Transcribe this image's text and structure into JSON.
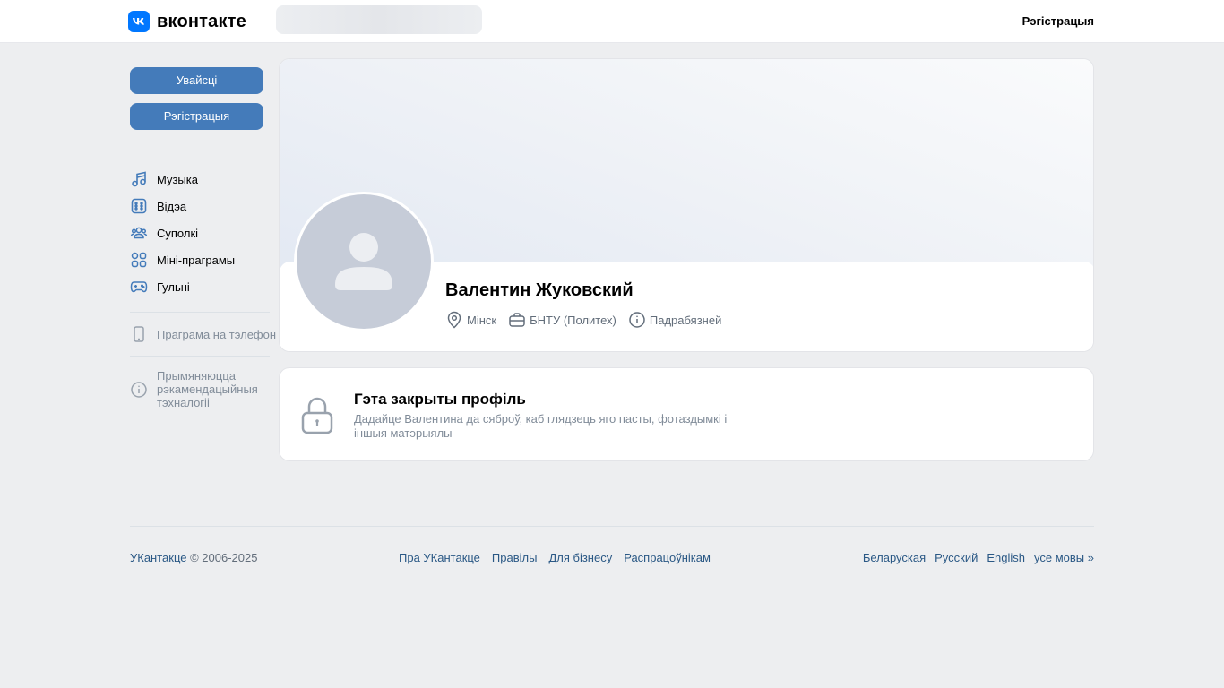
{
  "header": {
    "logo_text": "вконтакте",
    "register_label": "Рэгістрацыя"
  },
  "sidebar": {
    "login_label": "Увайсці",
    "register_label": "Рэгістрацыя",
    "items": [
      {
        "label": "Музыка",
        "icon": "music-icon"
      },
      {
        "label": "Відэа",
        "icon": "video-icon"
      },
      {
        "label": "Суполкі",
        "icon": "groups-icon"
      },
      {
        "label": "Міні-праграмы",
        "icon": "apps-icon"
      },
      {
        "label": "Гульні",
        "icon": "gamepad-icon"
      }
    ],
    "phone_app_label": "Праграма на тэлефон",
    "recommendations_label": "Прымяняюцца рэкамендацыйныя тэхналогіі"
  },
  "profile": {
    "name": "Валентин Жуковский",
    "city": "Мінск",
    "university": "БНТУ (Политех)",
    "details_label": "Падрабязней"
  },
  "closed_profile": {
    "title": "Гэта закрыты профіль",
    "description": "Дадайце Валентина да сяброў, каб глядзець яго пасты, фотаздымкі і іншыя матэрыялы"
  },
  "footer": {
    "brand": "УКантакце",
    "copyright": " © 2006-2025",
    "links": [
      "Пра УКантакце",
      "Правілы",
      "Для бізнесу",
      "Распрацоўнікам"
    ],
    "languages": [
      "Беларуская",
      "Русский",
      "English",
      "усе мовы »"
    ]
  },
  "colors": {
    "accent": "#447bba",
    "link": "#2a5885",
    "background": "#edeef0",
    "logo": "#0077ff",
    "icon": "#447bba"
  }
}
